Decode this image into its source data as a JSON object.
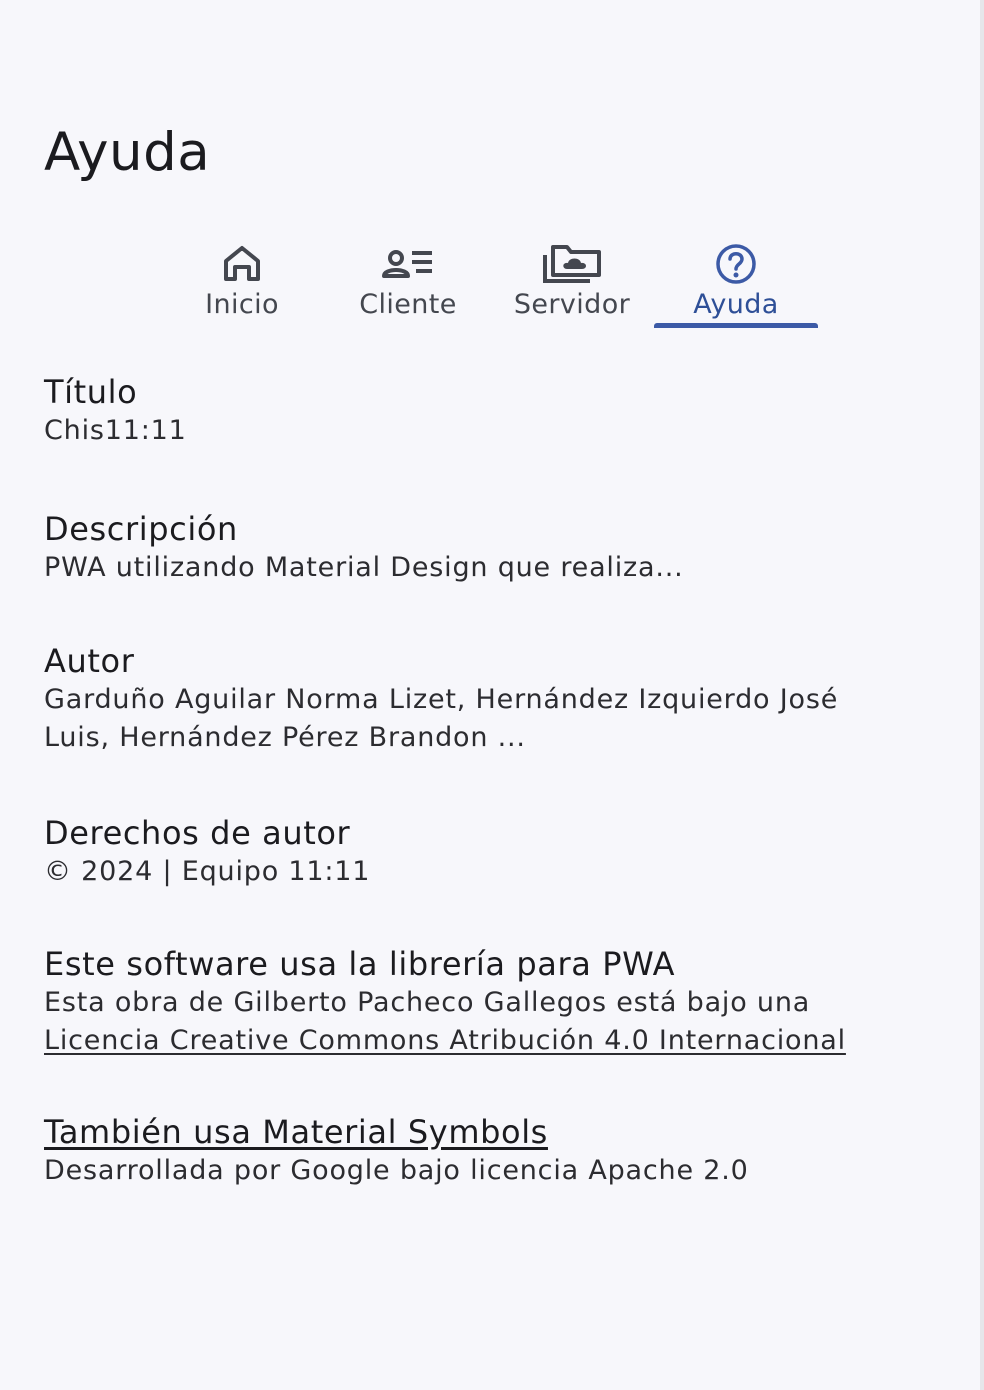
{
  "page": {
    "title": "Ayuda"
  },
  "tabs": [
    {
      "label": "Inicio",
      "icon": "home-icon",
      "active": false
    },
    {
      "label": "Cliente",
      "icon": "person-list-icon",
      "active": false
    },
    {
      "label": "Servidor",
      "icon": "folder-cloud-icon",
      "active": false
    },
    {
      "label": "Ayuda",
      "icon": "help-circle-icon",
      "active": true
    }
  ],
  "sections": {
    "titulo": {
      "title": "Título",
      "text": "Chis11:11"
    },
    "descripcion": {
      "title": "Descripción",
      "text": "PWA utilizando Material Design que realiza..."
    },
    "autor": {
      "title": "Autor",
      "text": "Garduño Aguilar Norma Lizet, Hernández Izquierdo José Luis, Hernández Pérez Brandon ..."
    },
    "derechos": {
      "title": "Derechos de autor",
      "text": "© 2024 | Equipo 11:11"
    },
    "libreria": {
      "title": "Este software usa la librería para PWA",
      "text_prefix": "Esta obra de Gilberto Pacheco Gallegos está bajo una ",
      "link_text": "Licencia Creative Commons Atribución 4.0 Internacional"
    },
    "material": {
      "title_link": "También usa Material Symbols",
      "text": "Desarrollada por Google bajo licencia Apache 2.0"
    }
  },
  "colors": {
    "background": "#f7f7fb",
    "primary": "#3c5aa6",
    "on_surface_variant": "#44474f"
  }
}
